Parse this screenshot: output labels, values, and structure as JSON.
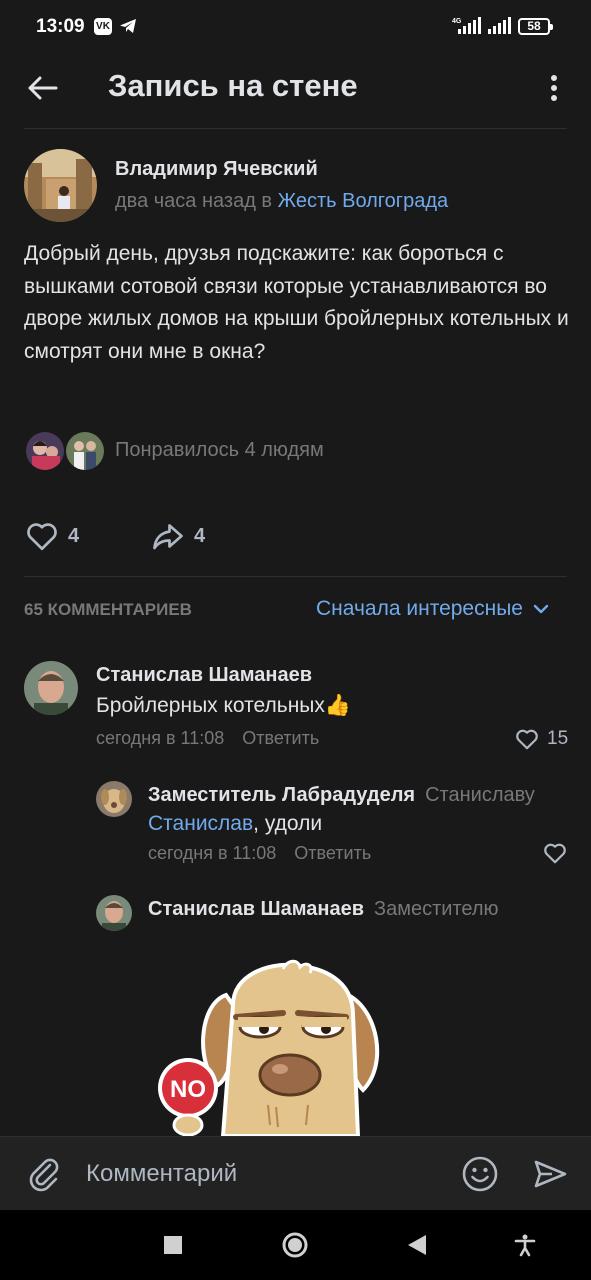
{
  "status_bar": {
    "time": "13:09",
    "vk_badge": "VK",
    "network": "4G",
    "battery": "58"
  },
  "header": {
    "title": "Запись на стене",
    "back_icon": "arrow-left-icon",
    "menu_icon": "more-vertical-icon"
  },
  "post": {
    "author": "Владимир Ячевский",
    "time_prefix": "два часа назад в",
    "group": "Жесть Волгограда",
    "text": "Добрый день, друзья подскажите: как бороться с вышками сотовой связи которые устанавливаются во дворе жилых домов на крыши бройлерных котельных и смотрят они мне в окна?",
    "likes_summary": "Понравилось 4 людям",
    "like_count": "4",
    "share_count": "4"
  },
  "comments_section": {
    "count_label": "65 КОММЕНТАРИЕВ",
    "sort_label": "Сначала интересные"
  },
  "comments": [
    {
      "author": "Станислав Шаманаев",
      "text": "Бройлерных котельных",
      "emoji": "👍",
      "time": "сегодня в 11:08",
      "reply_label": "Ответить",
      "likes": "15"
    },
    {
      "author": "Заместитель Лабрадуделя",
      "reply_to": "Станиславу",
      "mention": "Станислав",
      "text": ", удоли",
      "time": "сегодня в 11:08",
      "reply_label": "Ответить"
    },
    {
      "author": "Станислав Шаманаев",
      "reply_to": "Заместителю",
      "sticker": "dog-no-sign-sticker",
      "sticker_text": "NO"
    }
  ],
  "composer": {
    "placeholder": "Комментарий",
    "attach_icon": "paperclip-icon",
    "emoji_icon": "smile-icon",
    "send_icon": "send-icon"
  },
  "colors": {
    "background": "#19191a",
    "accent": "#71aaeb",
    "text_primary": "#e1e3e6",
    "text_secondary": "#76787a"
  }
}
